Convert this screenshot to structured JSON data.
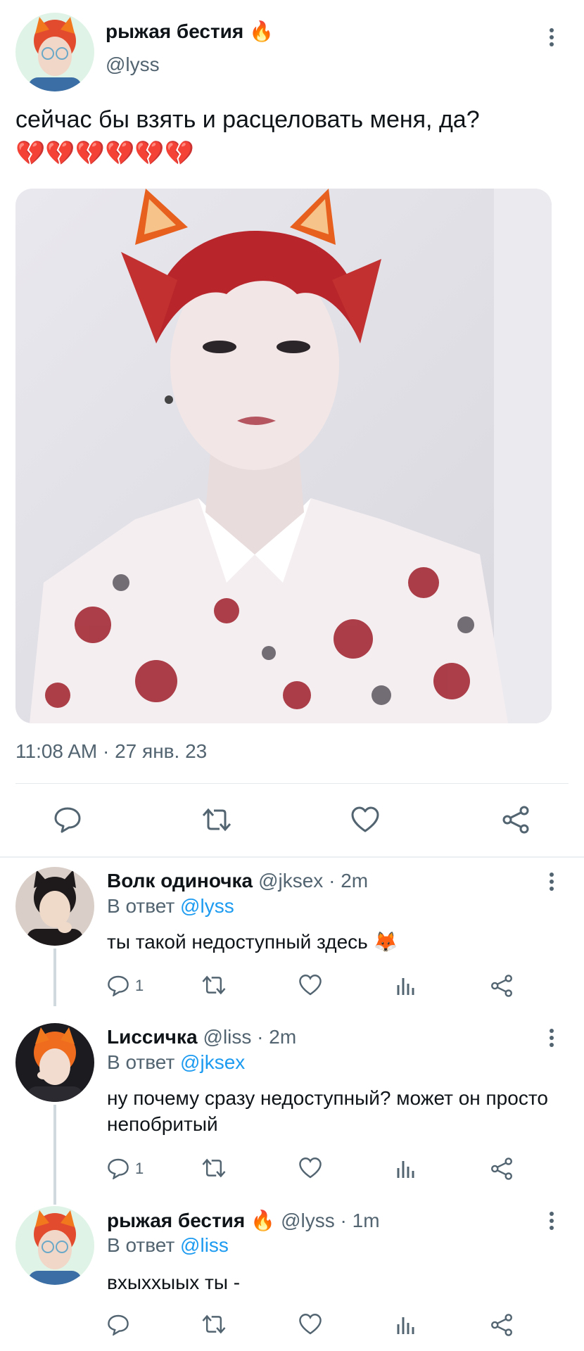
{
  "tweet": {
    "display_name": "рыжая бестия",
    "name_emoji": "🔥",
    "handle": "@lyss",
    "text": "сейчас бы взять и расцеловать меня, да?",
    "hearts_emoji": "💔💔💔💔💔💔",
    "timestamp": "11:08 AM · 27 янв. 23",
    "icons": [
      "reply-icon",
      "retweet-icon",
      "like-icon",
      "share-icon"
    ]
  },
  "replies": [
    {
      "name": "Волк одиночка",
      "handle_time": "@jksex · 2m",
      "reply_prefix": "В ответ",
      "reply_to": "@lyss",
      "text": "ты такой недоступный здесь",
      "text_emoji": "🦊",
      "reply_count": "1"
    },
    {
      "name": "Lиссичка",
      "handle_time": "@liss · 2m",
      "reply_prefix": "В ответ",
      "reply_to": "@jksex",
      "text": "ну почему сразу недоступный? может он просто непобритый",
      "reply_count": "1"
    },
    {
      "name": "рыжая бестия",
      "name_emoji": "🔥",
      "handle_time": "@lyss · 1m",
      "reply_prefix": "В ответ",
      "reply_to": "@liss",
      "text": "вхыххыых ты -",
      "reply_count": ""
    }
  ],
  "colors": {
    "text": "#0f1419",
    "secondary": "#536471",
    "link": "#1d9bf0",
    "divider": "#e6e9ec"
  }
}
